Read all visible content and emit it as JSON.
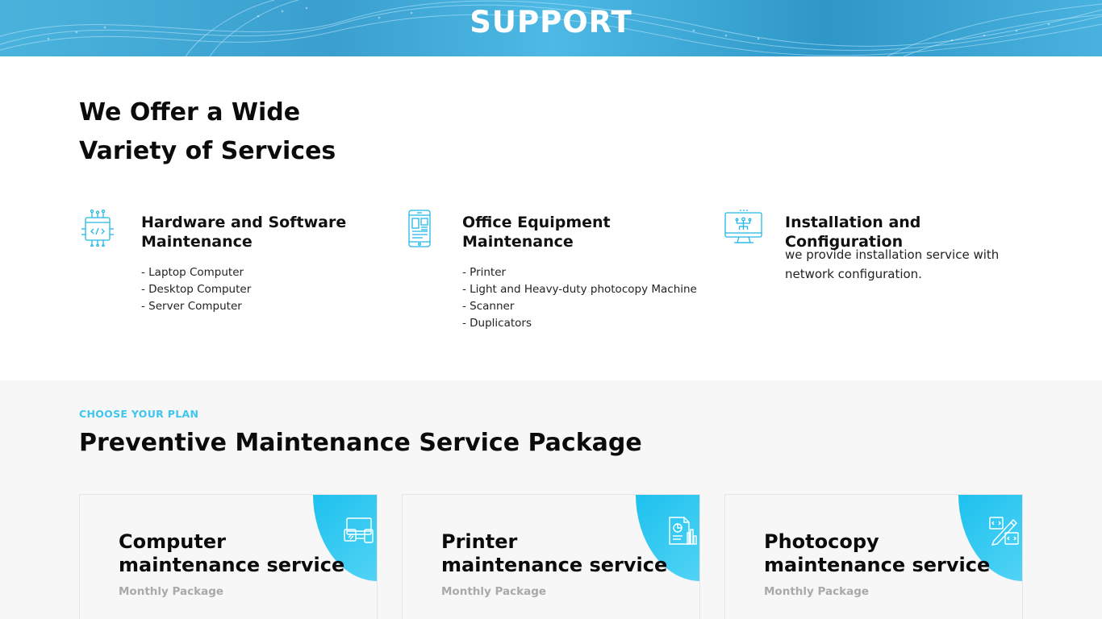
{
  "banner": {
    "title": "SUPPORT"
  },
  "services": {
    "heading_line1": "We Offer a Wide",
    "heading_line2": "Variety of Services",
    "items": [
      {
        "icon": "circuit-code-icon",
        "title_line1": "Hardware and Software",
        "title_line2": "Maintenance",
        "list": [
          "- Laptop Computer",
          "- Desktop Computer",
          "- Server Computer"
        ]
      },
      {
        "icon": "mobile-device-icon",
        "title_line1": "Office Equipment",
        "title_line2": "Maintenance",
        "list": [
          "- Printer",
          "- Light and Heavy-duty photocopy Machine",
          "- Scanner",
          "- Duplicators"
        ]
      },
      {
        "icon": "monitor-network-icon",
        "title_line1": "Installation and Configuration",
        "text": "we provide installation service with network configuration."
      }
    ]
  },
  "plans": {
    "eyebrow": "CHOOSE YOUR PLAN",
    "title": "Preventive Maintenance Service Package",
    "cards": [
      {
        "icon": "devices-icon",
        "title_line1": "Computer",
        "title_line2": "maintenance service",
        "subtitle": "Monthly Package"
      },
      {
        "icon": "report-chart-icon",
        "title_line1": "Printer",
        "title_line2": "maintenance service",
        "subtitle": "Monthly Package"
      },
      {
        "icon": "code-edit-icon",
        "title_line1": "Photocopy",
        "title_line2": "maintenance service",
        "subtitle": "Monthly Package"
      }
    ]
  },
  "colors": {
    "accent": "#3ec6ee",
    "icon_stroke": "#22b8e6",
    "banner": "#3ba6d6",
    "plans_bg": "#f7f7f7"
  }
}
